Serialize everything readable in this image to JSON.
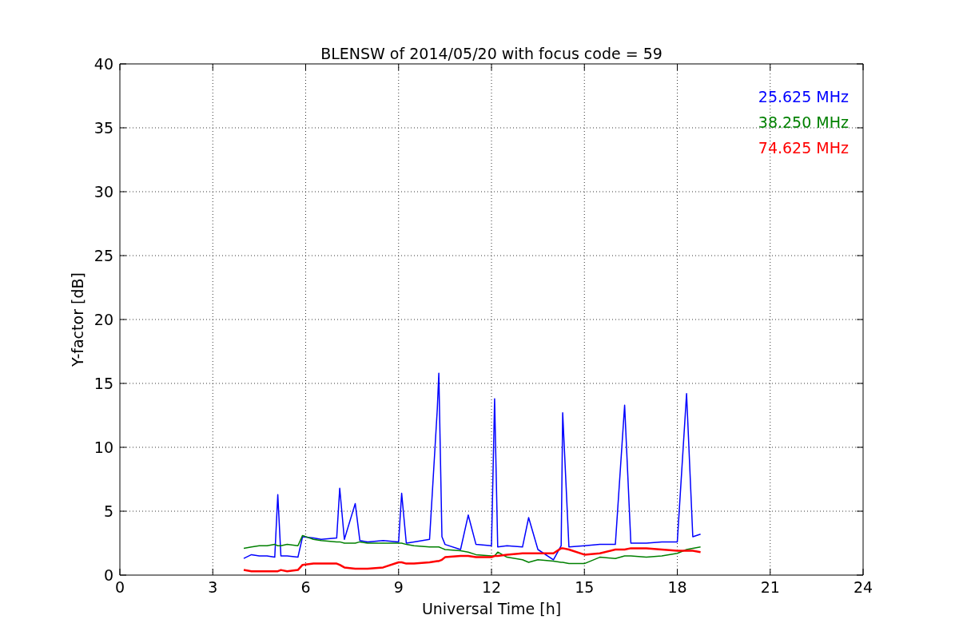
{
  "chart_data": {
    "type": "line",
    "title": "BLENSW of 2014/05/20 with focus code = 59",
    "xlabel": "Universal Time [h]",
    "ylabel": "Y-factor [dB]",
    "x": [
      4.0,
      4.25,
      4.5,
      4.75,
      5.0,
      5.1,
      5.2,
      5.4,
      5.75,
      5.9,
      6.25,
      6.5,
      7.0,
      7.1,
      7.25,
      7.6,
      7.75,
      8.0,
      8.5,
      9.0,
      9.1,
      9.25,
      9.5,
      10.0,
      10.25,
      10.3,
      10.4,
      10.5,
      11.0,
      11.25,
      11.5,
      12.0,
      12.1,
      12.2,
      12.5,
      13.0,
      13.2,
      13.5,
      14.0,
      14.25,
      14.3,
      14.5,
      15.0,
      15.5,
      16.0,
      16.3,
      16.5,
      17.0,
      17.5,
      18.0,
      18.3,
      18.5,
      18.75
    ],
    "grid": true,
    "xlim": [
      0,
      24
    ],
    "ylim": [
      0,
      40
    ],
    "xticks": [
      0,
      3,
      6,
      9,
      12,
      15,
      18,
      21,
      24
    ],
    "yticks": [
      0,
      5,
      10,
      15,
      20,
      25,
      30,
      35,
      40
    ],
    "series": [
      {
        "name": "25.625 MHz",
        "color": "#0000ff",
        "values": [
          1.3,
          1.6,
          1.5,
          1.5,
          1.4,
          6.3,
          1.5,
          1.5,
          1.4,
          3.0,
          2.9,
          2.8,
          2.9,
          6.8,
          2.8,
          5.6,
          2.7,
          2.6,
          2.7,
          2.6,
          6.4,
          2.5,
          2.6,
          2.8,
          13.0,
          15.8,
          3.0,
          2.4,
          2.0,
          4.7,
          2.4,
          2.3,
          13.8,
          2.2,
          2.3,
          2.2,
          4.5,
          2.0,
          1.2,
          2.3,
          12.7,
          2.2,
          2.3,
          2.4,
          2.4,
          13.3,
          2.5,
          2.5,
          2.6,
          2.6,
          14.2,
          3.0,
          3.2
        ]
      },
      {
        "name": "38.250 MHz",
        "color": "#008000",
        "values": [
          2.1,
          2.2,
          2.3,
          2.3,
          2.4,
          2.3,
          2.3,
          2.4,
          2.3,
          3.1,
          2.8,
          2.7,
          2.6,
          2.6,
          2.5,
          2.5,
          2.6,
          2.5,
          2.5,
          2.5,
          2.5,
          2.4,
          2.3,
          2.2,
          2.2,
          2.2,
          2.1,
          2.0,
          1.9,
          1.8,
          1.6,
          1.5,
          1.5,
          1.8,
          1.4,
          1.2,
          1.0,
          1.2,
          1.1,
          1.0,
          1.0,
          0.9,
          0.9,
          1.4,
          1.3,
          1.5,
          1.5,
          1.4,
          1.5,
          1.7,
          2.0,
          2.1,
          2.2
        ]
      },
      {
        "name": "74.625 MHz",
        "color": "#ff0000",
        "values": [
          0.4,
          0.3,
          0.3,
          0.3,
          0.3,
          0.3,
          0.4,
          0.3,
          0.4,
          0.8,
          0.9,
          0.9,
          0.9,
          0.8,
          0.6,
          0.5,
          0.5,
          0.5,
          0.6,
          1.0,
          1.0,
          0.9,
          0.9,
          1.0,
          1.1,
          1.1,
          1.2,
          1.4,
          1.5,
          1.5,
          1.4,
          1.4,
          1.5,
          1.5,
          1.6,
          1.7,
          1.7,
          1.7,
          1.7,
          2.1,
          2.1,
          2.0,
          1.6,
          1.7,
          2.0,
          2.0,
          2.1,
          2.1,
          2.0,
          1.9,
          1.9,
          1.9,
          1.8
        ]
      }
    ]
  }
}
